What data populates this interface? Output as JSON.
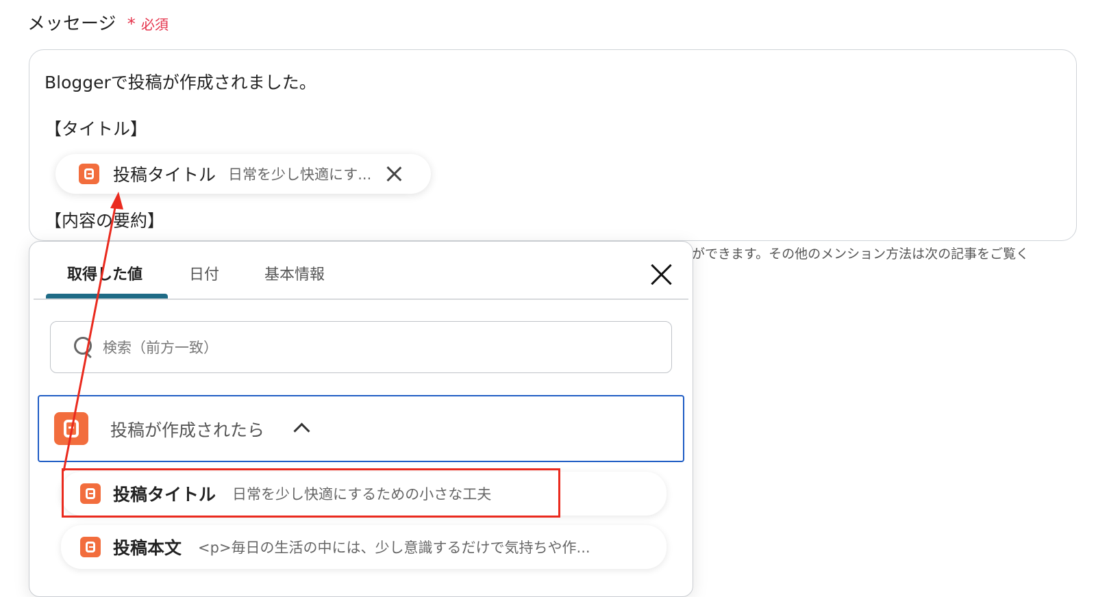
{
  "field": {
    "label": "メッセージ",
    "required_mark": "*",
    "required_text": "必須"
  },
  "message": {
    "line1": "Bloggerで投稿が作成されました。",
    "line2": "【タイトル】",
    "line3": "【内容の要約】",
    "chip": {
      "icon": "blogger-icon",
      "label": "投稿タイトル",
      "value": "日常を少し快適にす..."
    }
  },
  "help_text": "ができます。その他のメンション方法は次の記事をご覧く",
  "panel": {
    "tabs": [
      {
        "label": "取得した値",
        "active": true
      },
      {
        "label": "日付",
        "active": false
      },
      {
        "label": "基本情報",
        "active": false
      }
    ],
    "search": {
      "placeholder": "検索（前方一致）",
      "value": ""
    },
    "group": {
      "label": "投稿が作成されたら",
      "icon": "blogger-icon",
      "expanded": true
    },
    "items": [
      {
        "label": "投稿タイトル",
        "value": "日常を少し快適にするための小さな工夫",
        "icon": "blogger-icon"
      },
      {
        "label": "投稿本文",
        "value": "<p>毎日の生活の中には、少し意識するだけで気持ちや作...",
        "icon": "blogger-icon"
      }
    ]
  },
  "colors": {
    "accent": "#1f6b86",
    "required": "#e5334b",
    "blogger": "#f26d3d",
    "group_border": "#1d5bc4",
    "annotation": "#ea2a1e"
  }
}
